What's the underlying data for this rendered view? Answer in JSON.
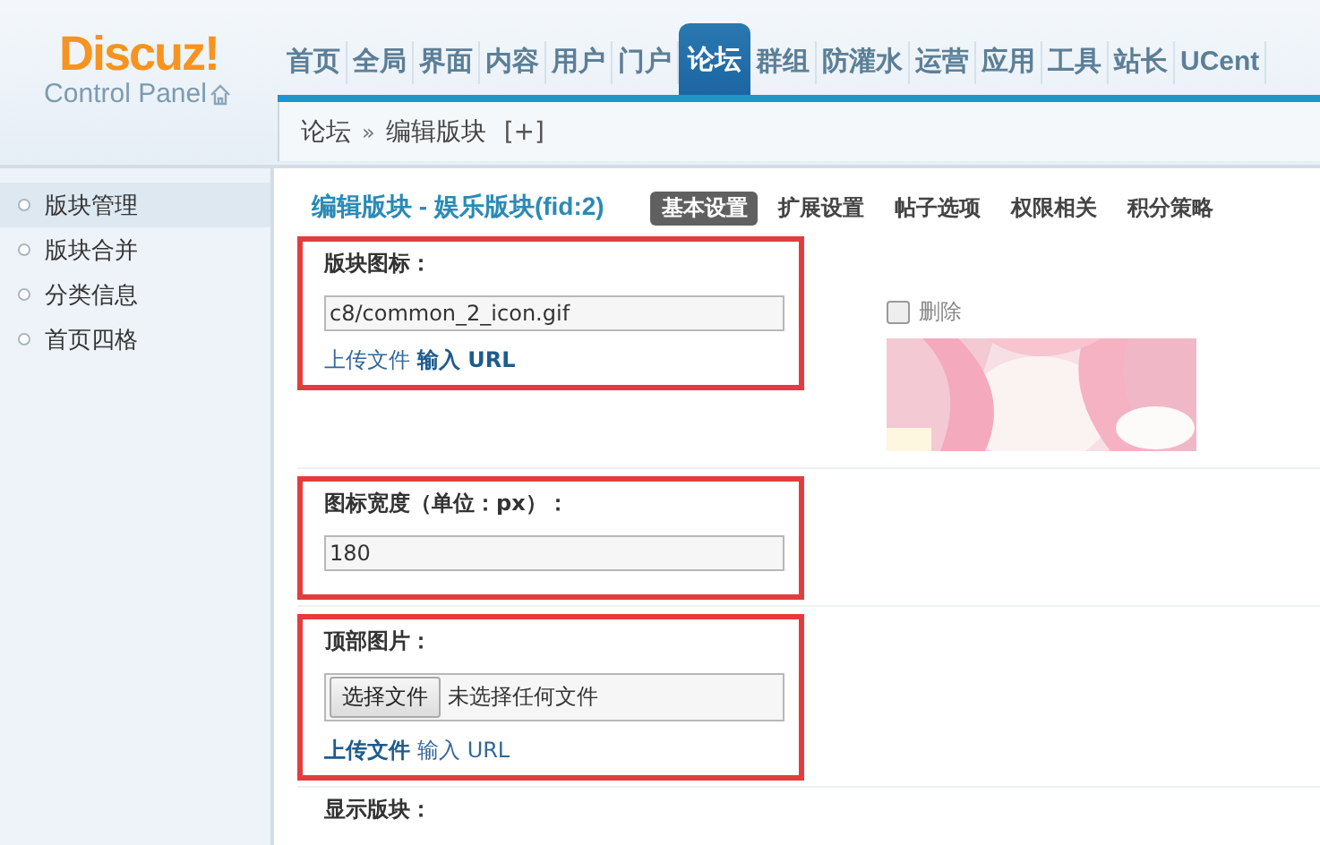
{
  "logo": {
    "name": "Discuz!",
    "subtitle": "Control Panel"
  },
  "nav": [
    {
      "label": "首页",
      "selected": false
    },
    {
      "label": "全局",
      "selected": false
    },
    {
      "label": "界面",
      "selected": false
    },
    {
      "label": "内容",
      "selected": false
    },
    {
      "label": "用户",
      "selected": false
    },
    {
      "label": "门户",
      "selected": false
    },
    {
      "label": "论坛",
      "selected": true
    },
    {
      "label": "群组",
      "selected": false
    },
    {
      "label": "防灌水",
      "selected": false
    },
    {
      "label": "运营",
      "selected": false
    },
    {
      "label": "应用",
      "selected": false
    },
    {
      "label": "工具",
      "selected": false
    },
    {
      "label": "站长",
      "selected": false
    },
    {
      "label": "UCent",
      "selected": false
    }
  ],
  "breadcrumb": {
    "items": [
      "论坛",
      "编辑版块"
    ],
    "separator": "»",
    "add": "[+]"
  },
  "sidebar": [
    {
      "label": "版块管理",
      "selected": true
    },
    {
      "label": "版块合并",
      "selected": false
    },
    {
      "label": "分类信息",
      "selected": false
    },
    {
      "label": "首页四格",
      "selected": false
    }
  ],
  "page": {
    "title": "编辑版块 - 娱乐版块(fid:2)",
    "tabs": [
      {
        "label": "基本设置",
        "selected": true
      },
      {
        "label": "扩展设置",
        "selected": false
      },
      {
        "label": "帖子选项",
        "selected": false
      },
      {
        "label": "权限相关",
        "selected": false
      },
      {
        "label": "积分策略",
        "selected": false
      }
    ]
  },
  "sections": [
    {
      "kind": "text",
      "label": "版块图标：",
      "highlighted": true,
      "value": "c8/common_2_icon.gif",
      "links": [
        {
          "label": "上传文件",
          "selected": false
        },
        {
          "label": "输入 URL",
          "selected": true
        }
      ],
      "delete": {
        "label": "删除",
        "checked": false
      }
    },
    {
      "kind": "text",
      "label": "图标宽度（单位：px）：",
      "highlighted": true,
      "value": "180"
    },
    {
      "kind": "file",
      "label": "顶部图片：",
      "highlighted": true,
      "button": "选择文件",
      "file_status": "未选择任何文件",
      "links": [
        {
          "label": "上传文件",
          "selected": true
        },
        {
          "label": "输入 URL",
          "selected": false
        }
      ]
    },
    {
      "kind": "heading",
      "label": "显示版块："
    }
  ]
}
